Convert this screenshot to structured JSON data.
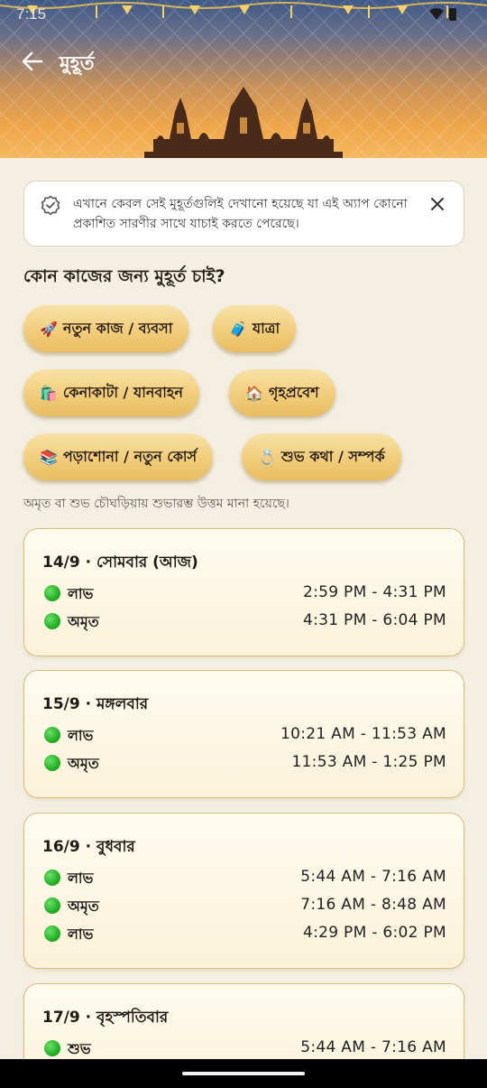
{
  "status": {
    "time": "7:15"
  },
  "appbar": {
    "title": "মুহূর্ত"
  },
  "notice": {
    "text": "এখানে কেবল সেই মুহূর্তগুলিই দেখানো হয়েছে যা এই অ্যাপ কোনো প্রকাশিত সারণীর সাথে যাচাই করতে পেরেছে।"
  },
  "question": "কোন কাজের জন্য মুহূর্ত চাই?",
  "chips": [
    {
      "emoji": "🚀",
      "label": "নতুন কাজ / ব্যবসা"
    },
    {
      "emoji": "🧳",
      "label": "যাত্রা"
    },
    {
      "emoji": "🛍️",
      "label": "কেনাকাটা / যানবাহন"
    },
    {
      "emoji": "🏠",
      "label": "গৃহপ্রবেশ"
    },
    {
      "emoji": "📚",
      "label": "পড়াশোনা / নতুন কোর্স"
    },
    {
      "emoji": "💍",
      "label": "শুভ কথা / সম্পর্ক"
    }
  ],
  "hint": "অমৃত বা শুভ চৌঘড়িয়ায় শুভারম্ভ উত্তম মানা হয়েছে।",
  "days": [
    {
      "day": "14/9 · সোমবার (আজ)",
      "slots": [
        {
          "name": "লাভ",
          "time": "2:59 PM - 4:31 PM"
        },
        {
          "name": "অমৃত",
          "time": "4:31 PM - 6:04 PM"
        }
      ]
    },
    {
      "day": "15/9 · মঙ্গলবার",
      "slots": [
        {
          "name": "লাভ",
          "time": "10:21 AM - 11:53 AM"
        },
        {
          "name": "অমৃত",
          "time": "11:53 AM - 1:25 PM"
        }
      ]
    },
    {
      "day": "16/9 · বুধবার",
      "slots": [
        {
          "name": "লাভ",
          "time": "5:44 AM - 7:16 AM"
        },
        {
          "name": "অমৃত",
          "time": "7:16 AM - 8:48 AM"
        },
        {
          "name": "লাভ",
          "time": "4:29 PM - 6:02 PM"
        }
      ]
    },
    {
      "day": "17/9 · বৃহস্পতিবার",
      "slots": [
        {
          "name": "শুভ",
          "time": "5:44 AM - 7:16 AM"
        }
      ]
    }
  ],
  "colors": {
    "accent_gold": "#f1cd7c",
    "slot_dot": "#22b022",
    "card_border": "#d9bf7a"
  }
}
